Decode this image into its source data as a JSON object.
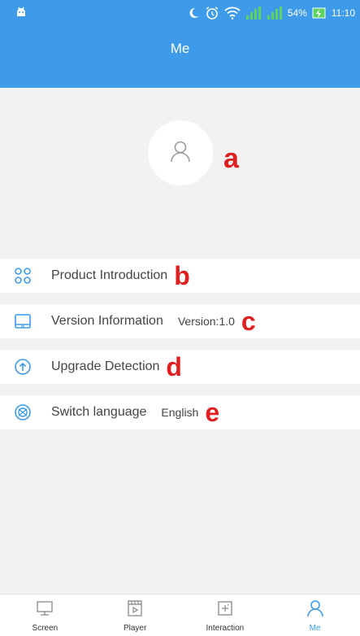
{
  "status_bar": {
    "battery_percent": "54%",
    "time": "11:10",
    "icons": [
      "android-icon",
      "moon-icon",
      "alarm-icon",
      "wifi-icon",
      "signal-icon",
      "signal-icon",
      "battery-charging-icon"
    ]
  },
  "header": {
    "title": "Me"
  },
  "profile": {
    "avatar_icon": "user-icon",
    "callout": "a"
  },
  "menu": {
    "items": [
      {
        "icon": "grid-clover-icon",
        "label": "Product Introduction",
        "value": "",
        "callout": "b"
      },
      {
        "icon": "tablet-icon",
        "label": "Version Information",
        "value": "Version:1.0",
        "callout": "c"
      },
      {
        "icon": "upload-arrow-icon",
        "label": "Upgrade Detection",
        "value": "",
        "callout": "d"
      },
      {
        "icon": "globe-icon",
        "label": "Switch language",
        "value": "English",
        "callout": "e"
      }
    ]
  },
  "bottom_nav": {
    "tabs": [
      {
        "icon": "monitor-icon",
        "label": "Screen",
        "active": false
      },
      {
        "icon": "clapper-icon",
        "label": "Player",
        "active": false
      },
      {
        "icon": "sparkle-screen-icon",
        "label": "Interaction",
        "active": false
      },
      {
        "icon": "user-icon",
        "label": "Me",
        "active": true
      }
    ]
  },
  "colors": {
    "primary": "#3d9bea",
    "callout": "#e02020",
    "background": "#f2f2f2",
    "text": "#444444"
  }
}
